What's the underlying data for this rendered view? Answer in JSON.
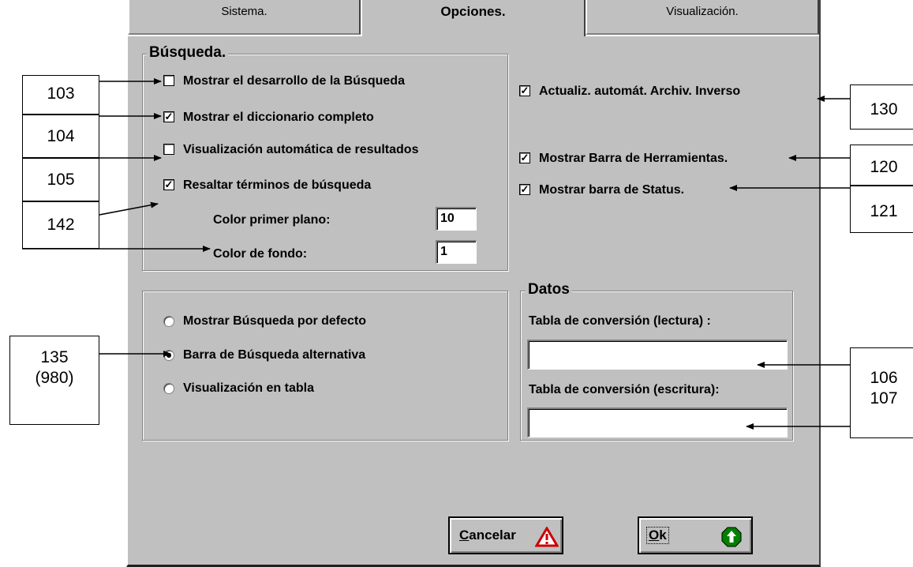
{
  "tabs": [
    "Sistema.",
    "Opciones.",
    "Visualización."
  ],
  "active_tab": "Opciones.",
  "busqueda": {
    "title": "Búsqueda.",
    "options": [
      {
        "label": "Mostrar el desarrollo de la Búsqueda",
        "checked": false
      },
      {
        "label": "Mostrar el diccionario completo",
        "checked": true
      },
      {
        "label": "Visualización automática de resultados",
        "checked": false
      },
      {
        "label": "Resaltar términos de búsqueda",
        "checked": true
      }
    ],
    "color_primer_plano_label": "Color primer plano:",
    "color_primer_plano_value": "10",
    "color_fondo_label": "Color de fondo:",
    "color_fondo_value": "1"
  },
  "right_options": [
    {
      "label": "Actualiz. automát. Archiv. Inverso",
      "checked": true
    },
    {
      "label": "Mostrar Barra de Herramientas.",
      "checked": true
    },
    {
      "label": "Mostrar barra de Status.",
      "checked": true
    }
  ],
  "radio_group": {
    "options": [
      {
        "label": "Mostrar Búsqueda por defecto",
        "selected": false
      },
      {
        "label": "Barra de Búsqueda alternativa",
        "selected": true
      },
      {
        "label": "Visualización en tabla",
        "selected": false
      }
    ]
  },
  "datos": {
    "title": "Datos",
    "lectura_label": "Tabla de conversión (lectura) :",
    "lectura_value": "",
    "escritura_label": "Tabla de conversión (escritura):",
    "escritura_value": ""
  },
  "buttons": {
    "cancel_label": "Cancelar",
    "cancel_mnemonic": "C",
    "cancel_rest": "ancelar",
    "ok_label": "Ok",
    "ok_mnemonic": "O",
    "ok_rest": "k"
  },
  "callouts": {
    "c103": "103",
    "c104": "104",
    "c105": "105",
    "c142": "142",
    "c135_line1": "135",
    "c135_line2": "(980)",
    "c130": "130",
    "c120": "120",
    "c121": "121",
    "c106": "106",
    "c107": "107"
  },
  "colors": {
    "dialog_face": "#c0c0c0",
    "warning_red": "#cc0000",
    "ok_green": "#008000"
  }
}
